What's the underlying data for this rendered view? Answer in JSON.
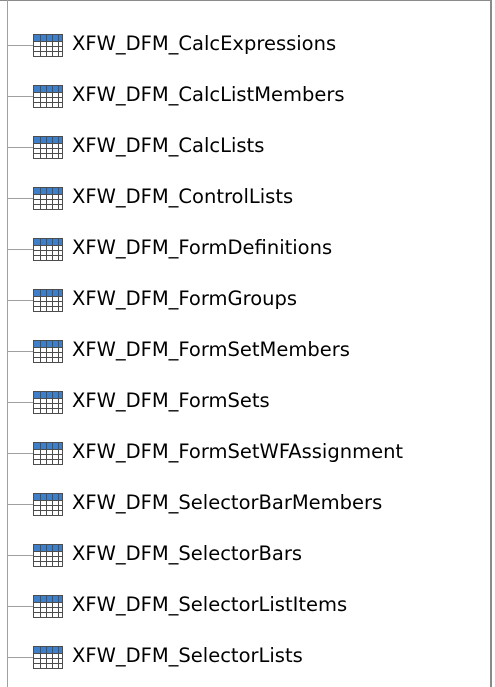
{
  "tree": {
    "items": [
      {
        "label": "XFW_DFM_CalcExpressions",
        "icon": "table-icon"
      },
      {
        "label": "XFW_DFM_CalcListMembers",
        "icon": "table-icon"
      },
      {
        "label": "XFW_DFM_CalcLists",
        "icon": "table-icon"
      },
      {
        "label": "XFW_DFM_ControlLists",
        "icon": "table-icon"
      },
      {
        "label": "XFW_DFM_FormDefinitions",
        "icon": "table-icon"
      },
      {
        "label": "XFW_DFM_FormGroups",
        "icon": "table-icon"
      },
      {
        "label": "XFW_DFM_FormSetMembers",
        "icon": "table-icon"
      },
      {
        "label": "XFW_DFM_FormSets",
        "icon": "table-icon"
      },
      {
        "label": "XFW_DFM_FormSetWFAssignment",
        "icon": "table-icon"
      },
      {
        "label": "XFW_DFM_SelectorBarMembers",
        "icon": "table-icon"
      },
      {
        "label": "XFW_DFM_SelectorBars",
        "icon": "table-icon"
      },
      {
        "label": "XFW_DFM_SelectorListItems",
        "icon": "table-icon"
      },
      {
        "label": "XFW_DFM_SelectorLists",
        "icon": "table-icon"
      }
    ]
  },
  "colors": {
    "tree_line": "#a0a0a0",
    "icon_border": "#4d4d4d",
    "icon_header": "#3f7fc8",
    "icon_cell": "#ffffff",
    "text": "#000000"
  }
}
